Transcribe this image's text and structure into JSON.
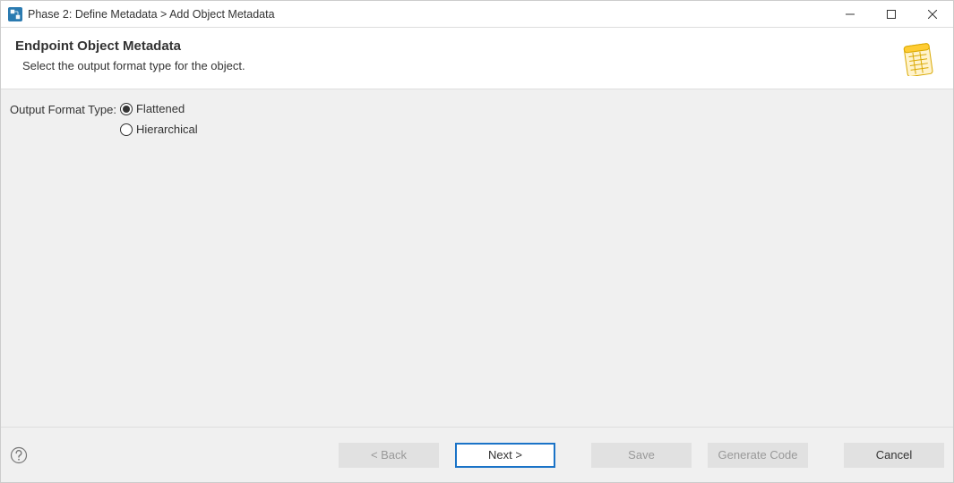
{
  "window": {
    "title": "Phase 2: Define Metadata > Add Object Metadata"
  },
  "header": {
    "title": "Endpoint Object Metadata",
    "subtitle": "Select the output format type for the object."
  },
  "form": {
    "output_format_label": "Output Format Type:",
    "options": {
      "flattened": "Flattened",
      "hierarchical": "Hierarchical"
    },
    "selected": "flattened"
  },
  "footer": {
    "back": "< Back",
    "next": "Next >",
    "save": "Save",
    "generate_code": "Generate Code",
    "cancel": "Cancel"
  }
}
